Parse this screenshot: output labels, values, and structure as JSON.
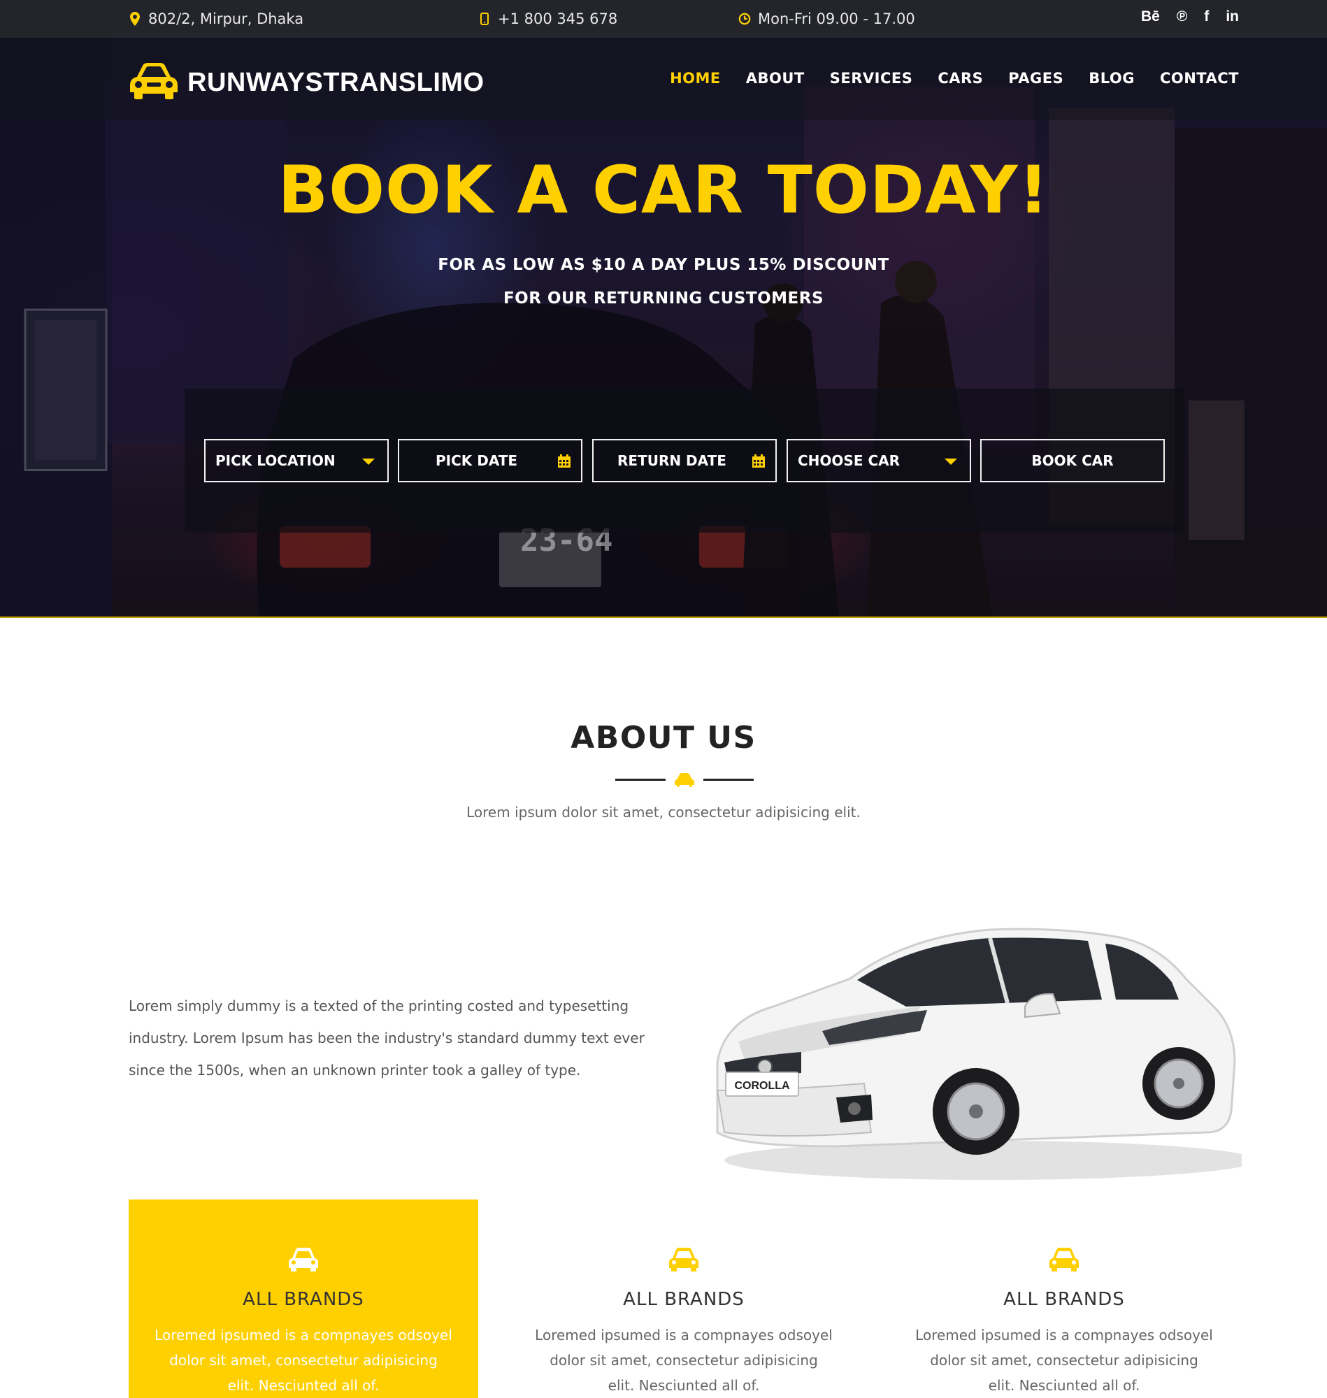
{
  "topbar": {
    "address": "802/2, Mirpur, Dhaka",
    "phone": "+1 800 345 678",
    "hours": "Mon-Fri 09.00 - 17.00",
    "social": [
      "Bē",
      "℗",
      "f",
      "in"
    ]
  },
  "header": {
    "brand": "RUNWAYSTRANSLIMO",
    "nav": [
      "HOME",
      "ABOUT",
      "SERVICES",
      "CARS",
      "PAGES",
      "BLOG",
      "CONTACT"
    ],
    "active_nav": "HOME"
  },
  "hero": {
    "title": "BOOK A CAR TODAY!",
    "subtitle_line1": "FOR AS LOW AS $10 A DAY PLUS 15% DISCOUNT",
    "subtitle_line2": "FOR OUR RETURNING CUSTOMERS",
    "plate": "23-64",
    "booking": {
      "pick_location": "PICK LOCATION",
      "pick_date": "PICK DATE",
      "return_date": "RETURN DATE",
      "choose_car": "CHOOSE CAR",
      "book_car": "BOOK CAR"
    }
  },
  "about": {
    "title": "ABOUT US",
    "lead": "Lorem ipsum dolor sit amet, consectetur adipisicing elit.",
    "body_line1": "Lorem simply dummy is a texted of the printing costed and typesetting",
    "body_line2": "industry. Lorem Ipsum has been the industry's standard dummy text ever",
    "body_line3": "since the 1500s, when an unknown printer took a galley of type.",
    "car_badge": "COROLLA"
  },
  "features": [
    {
      "title": "ALL BRANDS",
      "line1": "Loremed ipsumed is a compnayes odsoyel",
      "line2": "dolor sit amet, consectetur adipisicing",
      "line3": "elit. Nesciunted all of."
    },
    {
      "title": "ALL BRANDS",
      "line1": "Loremed ipsumed is a compnayes odsoyel",
      "line2": "dolor sit amet, consectetur adipisicing",
      "line3": "elit. Nesciunted all of."
    },
    {
      "title": "ALL BRANDS",
      "line1": "Loremed ipsumed is a compnayes odsoyel",
      "line2": "dolor sit amet, consectetur adipisicing",
      "line3": "elit. Nesciunted all of."
    }
  ],
  "colors": {
    "accent": "#ffd000",
    "topbar": "#23252b",
    "text_dark": "#222222"
  }
}
